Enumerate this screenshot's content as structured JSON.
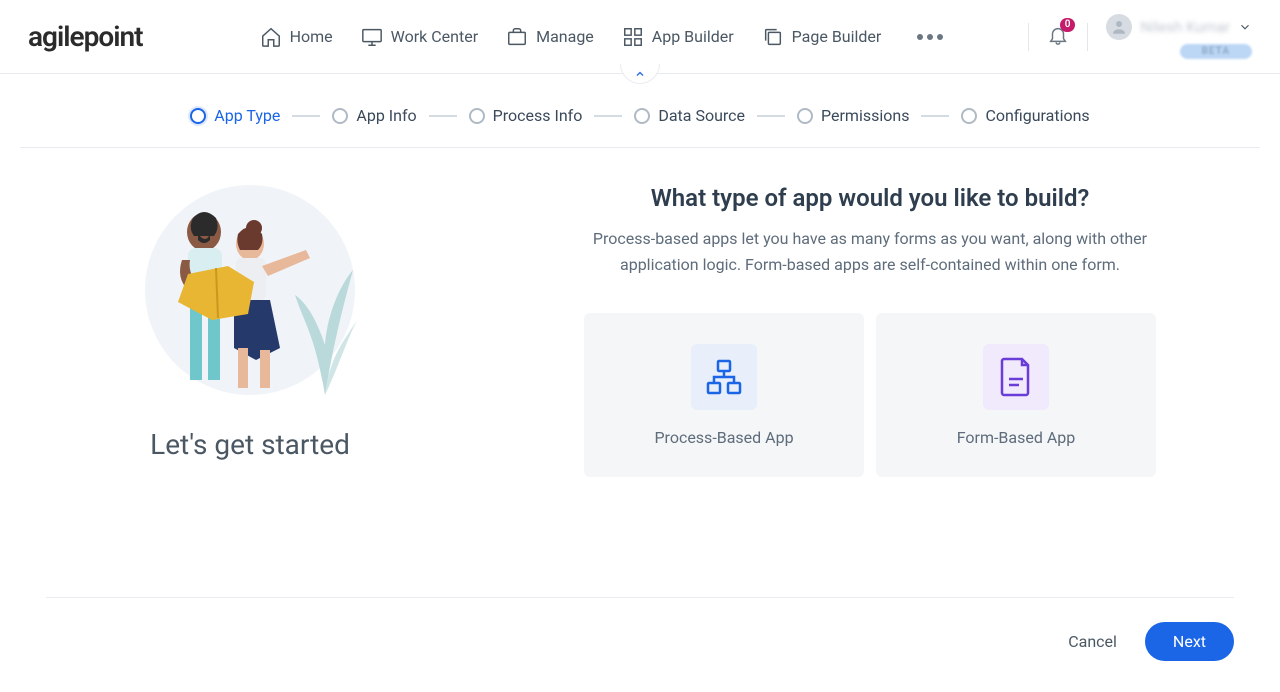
{
  "logo": "agilepoint",
  "nav": {
    "home": "Home",
    "work_center": "Work Center",
    "manage": "Manage",
    "app_builder": "App Builder",
    "page_builder": "Page Builder"
  },
  "notifications": {
    "count": "0"
  },
  "user": {
    "name": "Nilesh Kumar",
    "beta_label": "BETA"
  },
  "stepper": {
    "steps": [
      {
        "label": "App Type",
        "active": true
      },
      {
        "label": "App Info",
        "active": false
      },
      {
        "label": "Process Info",
        "active": false
      },
      {
        "label": "Data Source",
        "active": false
      },
      {
        "label": "Permissions",
        "active": false
      },
      {
        "label": "Configurations",
        "active": false
      }
    ]
  },
  "left_panel": {
    "heading": "Let's get started"
  },
  "main": {
    "title": "What type of app would you like to build?",
    "description": "Process-based apps let you have as many forms as you want, along with other application logic. Form-based apps are self-contained within one form.",
    "options": {
      "process": "Process-Based App",
      "form": "Form-Based App"
    }
  },
  "footer": {
    "cancel": "Cancel",
    "next": "Next"
  }
}
